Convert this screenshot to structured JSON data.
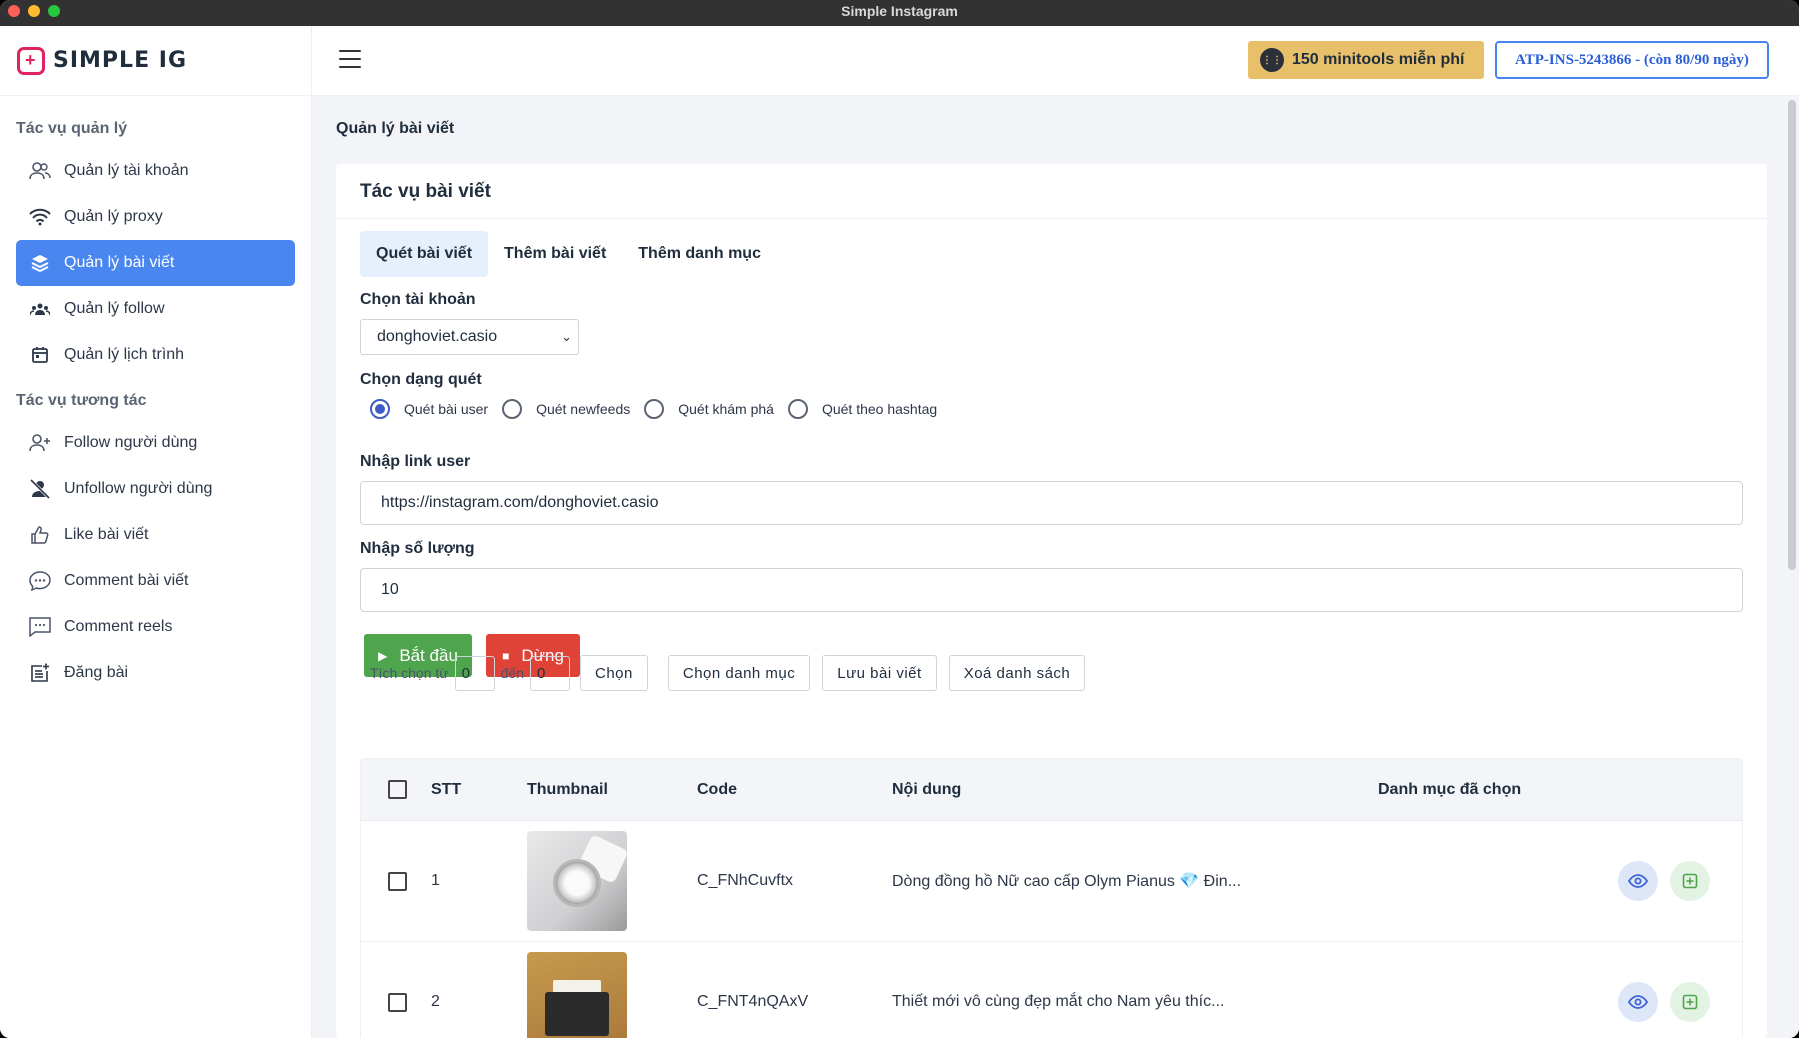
{
  "window": {
    "title": "Simple Instagram"
  },
  "brand": {
    "name": "SIMPLE IG"
  },
  "sidebar": {
    "sections": [
      {
        "title": "Tác vụ quản lý",
        "items": [
          {
            "label": "Quản lý tài khoản",
            "icon": "users-icon"
          },
          {
            "label": "Quản lý proxy",
            "icon": "wifi-icon"
          },
          {
            "label": "Quản lý bài viết",
            "icon": "layers-icon",
            "active": true
          },
          {
            "label": "Quản lý follow",
            "icon": "group-icon"
          },
          {
            "label": "Quản lý lịch trình",
            "icon": "calendar-icon"
          }
        ]
      },
      {
        "title": "Tác vụ tương tác",
        "items": [
          {
            "label": "Follow người dùng",
            "icon": "user-plus-icon"
          },
          {
            "label": "Unfollow người dùng",
            "icon": "user-off-icon"
          },
          {
            "label": "Like bài viết",
            "icon": "thumbs-up-icon"
          },
          {
            "label": "Comment bài viết",
            "icon": "chat-bubble-icon"
          },
          {
            "label": "Comment reels",
            "icon": "message-square-icon"
          },
          {
            "label": "Đăng bài",
            "icon": "post-add-icon"
          }
        ]
      }
    ]
  },
  "header": {
    "minitools_label": "150 minitools miễn phí",
    "license_label": "ATP-INS-5243866 - (còn 80/90 ngày)"
  },
  "page": {
    "title": "Quản lý bài viết",
    "card_title": "Tác vụ bài viết",
    "tabs": [
      "Quét bài viết",
      "Thêm bài viết",
      "Thêm danh mục"
    ],
    "account_label": "Chọn tài khoản",
    "account_value": "donghoviet.casio",
    "scan_type_label": "Chọn dạng quét",
    "scan_types": [
      "Quét bài user",
      "Quét newfeeds",
      "Quét khám phá",
      "Quét theo hashtag"
    ],
    "link_label": "Nhập link user",
    "link_value": "https://instagram.com/donghoviet.casio",
    "quantity_label": "Nhập số lượng",
    "quantity_value": "10",
    "start_label": "Bắt đầu",
    "stop_label": "Dừng",
    "range_from_label": "Tích chọn từ",
    "range_from_value": "0",
    "range_to_label": "đến",
    "range_to_value": "0",
    "choose_label": "Chọn",
    "choose_category_label": "Chọn danh mục",
    "save_posts_label": "Lưu bài viết",
    "clear_list_label": "Xoá danh sách"
  },
  "table": {
    "columns": [
      "STT",
      "Thumbnail",
      "Code",
      "Nội dung",
      "Danh mục đã chọn"
    ],
    "rows": [
      {
        "stt": "1",
        "code": "C_FNhCuvftx",
        "content": "Dòng đồng hồ Nữ cao cấp Olym Pianus 💎 Đin...",
        "category": ""
      },
      {
        "stt": "2",
        "code": "C_FNT4nQAxV",
        "content": "Thiết mới vô cùng đẹp mắt cho Nam yêu thíc...",
        "category": ""
      }
    ]
  },
  "colors": {
    "accent": "#4a86f0",
    "start_button": "#4fa44e",
    "stop_button": "#df4237",
    "minitools_button": "#e8c06a"
  }
}
